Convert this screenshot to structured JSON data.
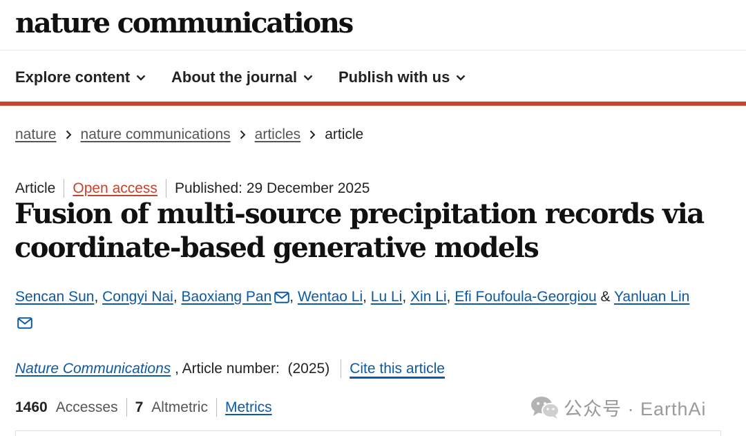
{
  "header": {
    "brand": "nature communications"
  },
  "nav": {
    "items": [
      {
        "label": "Explore content"
      },
      {
        "label": "About the journal"
      },
      {
        "label": "Publish with us"
      }
    ]
  },
  "breadcrumb": {
    "items": [
      {
        "label": "nature"
      },
      {
        "label": "nature communications"
      },
      {
        "label": "articles"
      },
      {
        "label": "article"
      }
    ]
  },
  "meta": {
    "type": "Article",
    "access": "Open access",
    "published": "Published: 29 December 2025"
  },
  "title": "Fusion of multi-source precipitation records via coordinate-based generative models",
  "authors": {
    "list": [
      "Sencan Sun",
      "Congyi Nai",
      "Baoxiang Pan",
      "Wentao Li",
      "Lu Li",
      "Xin Li",
      "Efi Foufoula-Georgiou",
      "Yanluan Lin"
    ],
    "separator": ", ",
    "final_separator": " & "
  },
  "journal_info": {
    "journal": "Nature Communications",
    "article_number": " , Article number:  (2025)",
    "cite_label": "Cite this article"
  },
  "metrics": {
    "accesses_count": "1460",
    "accesses_label": "Accesses",
    "altmetric_count": "7",
    "altmetric_label": "Altmetric",
    "metrics_link": "Metrics"
  },
  "watermark": {
    "text": "公众号 · EarthAi"
  },
  "icons": {
    "chevron": "chevron-down-icon",
    "mail": "mail-icon",
    "wechat": "wechat-icon"
  },
  "colors": {
    "accent_red": "#c8432b",
    "link_blue": "#0b5aa3",
    "text": "#222222"
  }
}
